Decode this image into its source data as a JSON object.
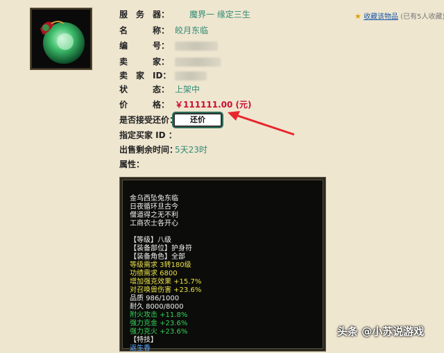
{
  "item": {
    "image": "jade-pendant-icon"
  },
  "favorite": {
    "link": "收藏该物品",
    "count": "(已有5人收藏)"
  },
  "fields": {
    "server_label": "服　务　器：",
    "server_value": "魔界一  缘定三生",
    "name_label": "名　　　称：",
    "name_value": "皎月东临",
    "id_label": "编　　　号：",
    "seller_label": "卖　　　家：",
    "seller_id_label": "卖　家　ID：",
    "status_label": "状　　　态：",
    "status_value": "上架中",
    "price_label": "价　　　格：",
    "price_value": "￥111111.00 (元)",
    "counter_label": "是否接受还价：",
    "counter_button": "还价",
    "buyer_label": "指定买家 ID ：",
    "time_label": "出售剩余时间：",
    "time_value": "5天23时",
    "attr_label": "属性："
  },
  "description": {
    "poem": [
      "金乌西坠兔东临",
      "日夜循环旦古今",
      "僧道得之无不利",
      "工商农士各开心"
    ],
    "lines": [
      {
        "text": "【等级】八级",
        "color": "white"
      },
      {
        "text": "【装备部位】护身符",
        "color": "white"
      },
      {
        "text": "【装备角色】全部",
        "color": "white"
      },
      {
        "text": "等级需求 3转180级",
        "color": "yellow"
      },
      {
        "text": "功绩需求 6800",
        "color": "yellow"
      },
      {
        "text": "增加强克效果 +15.7%",
        "color": "yellow"
      },
      {
        "text": "对召唤兽伤害 +23.6%",
        "color": "yellow"
      },
      {
        "text": "品质 986/1000",
        "color": "white"
      },
      {
        "text": "耐久 8000/8000",
        "color": "white"
      },
      {
        "text": "附火攻击 +11.8%",
        "color": "green"
      },
      {
        "text": "强力克金 +23.6%",
        "color": "green"
      },
      {
        "text": "强力克火 +23.6%",
        "color": "green"
      },
      {
        "text": "【特技】",
        "color": "white"
      },
      {
        "text": "返生香",
        "color": "blue"
      }
    ]
  },
  "watermark": "头条 @小苏说游戏"
}
